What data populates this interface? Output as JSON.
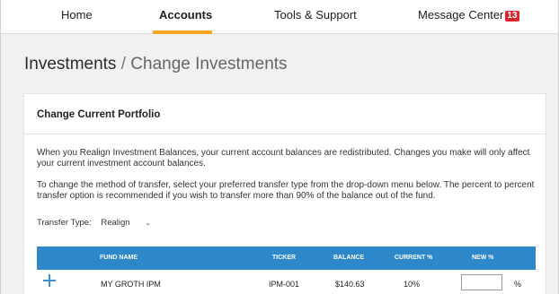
{
  "nav": {
    "items": [
      {
        "label": "Home"
      },
      {
        "label": "Accounts"
      },
      {
        "label": "Tools & Support"
      },
      {
        "label": "Message Center"
      }
    ],
    "message_count": "13",
    "active": "Accounts"
  },
  "page": {
    "title": "Investments",
    "separator": "/",
    "subtitle": "Change Investments"
  },
  "card": {
    "title": "Change Current Portfolio",
    "paragraph1": "When you Realign Investment Balances, your current account balances are redistributed. Changes you make will only affect your current investment account balances.",
    "paragraph2": "To change the method of transfer, select your preferred transfer type from the drop-down menu below. The percent to percent transfer option is recommended if you wish to transfer more than 90% of the balance out of the fund.",
    "transfer_label": "Transfer Type:",
    "transfer_value": "Realign"
  },
  "table": {
    "headers": {
      "fund_name": "FUND NAME",
      "ticker": "TICKER",
      "balance": "BALANCE",
      "current": "CURRENT %",
      "new": "NEW %"
    },
    "rows": [
      {
        "fund_name": "MY GROTH IPM",
        "ticker": "IPM-001",
        "balance": "$140.63",
        "current": "10%",
        "new_value": "",
        "unit": "%"
      }
    ]
  },
  "colors": {
    "accent_underline": "#f5a623",
    "table_header": "#2d87c8",
    "badge": "#d9262e",
    "plus_icon": "#3a8fd0"
  },
  "icons": {
    "expand_row": "plus-icon",
    "dropdown": "chevron-down-icon"
  }
}
